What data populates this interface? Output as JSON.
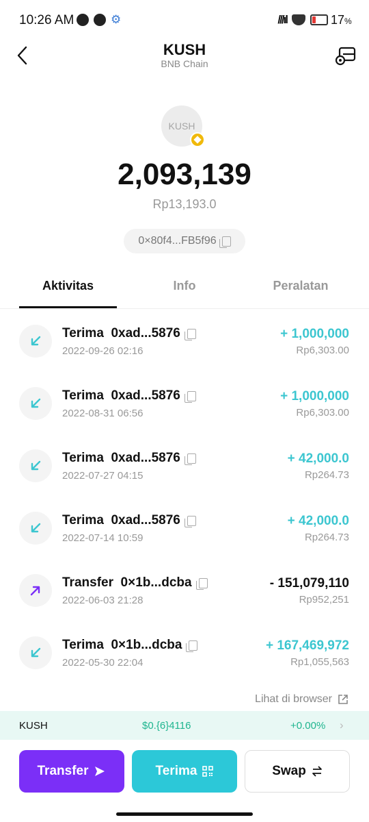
{
  "status_bar": {
    "time": "10:26 AM",
    "signal": "///ıl",
    "battery": "17",
    "battery_unit": "%",
    "battery_level": 0.17
  },
  "header": {
    "title": "KUSH",
    "subtitle": "BNB Chain"
  },
  "token": {
    "logo_text": "KUSH",
    "balance": "2,093,139",
    "fiat_value": "Rp13,193.0",
    "address": "0×80f4...FB5f96"
  },
  "tabs": [
    {
      "label": "Aktivitas",
      "active": true
    },
    {
      "label": "Info",
      "active": false
    },
    {
      "label": "Peralatan",
      "active": false
    }
  ],
  "activities": [
    {
      "type": "in",
      "title": "Terima  0xad...5876",
      "date": "2022-09-26 02:16",
      "amount": "+ 1,000,000",
      "fiat": "Rp6,303.00"
    },
    {
      "type": "in",
      "title": "Terima  0xad...5876",
      "date": "2022-08-31 06:56",
      "amount": "+ 1,000,000",
      "fiat": "Rp6,303.00"
    },
    {
      "type": "in",
      "title": "Terima  0xad...5876",
      "date": "2022-07-27 04:15",
      "amount": "+ 42,000.0",
      "fiat": "Rp264.73"
    },
    {
      "type": "in",
      "title": "Terima  0xad...5876",
      "date": "2022-07-14 10:59",
      "amount": "+ 42,000.0",
      "fiat": "Rp264.73"
    },
    {
      "type": "out",
      "title": "Transfer  0×1b...dcba",
      "date": "2022-06-03 21:28",
      "amount": "- 151,079,110",
      "fiat": "Rp952,251"
    },
    {
      "type": "in",
      "title": "Terima  0×1b...dcba",
      "date": "2022-05-30 22:04",
      "amount": "+ 167,469,972",
      "fiat": "Rp1,055,563"
    }
  ],
  "browser_link": "Lihat di browser",
  "ticker": {
    "symbol": "KUSH",
    "price": "$0.{6}4116",
    "change": "+0.00%"
  },
  "actions": {
    "transfer": "Transfer",
    "receive": "Terima",
    "swap": "Swap"
  },
  "colors": {
    "transfer_button": "#7b2ff7",
    "receive_button": "#2cc8d8",
    "incoming_amount": "#3cc6d0",
    "ticker_green": "#1fb58f",
    "ticker_bg": "#e8f8f4"
  }
}
